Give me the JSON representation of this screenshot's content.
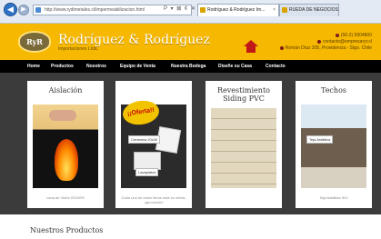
{
  "browser": {
    "url": "http://www.rydimetales.cl/impermeabilizacion.html",
    "address_tools": "P ▾ ⊠ ¢ ✕",
    "tabs": [
      {
        "label": "Rodríguez & Rodríguez Im...",
        "close": "×"
      },
      {
        "label": "RUEDA DE NEGOCIOS",
        "close": ""
      }
    ]
  },
  "header": {
    "logo_text": "RyR",
    "brand": "Rodríguez & Rodríguez",
    "tagline": "Importaciones Ltda.",
    "phone": "(56-2) 5904800",
    "email": "contacto@empresaryr.cl",
    "address": "Román Díaz 205, Providencia - Stgo. Chile"
  },
  "nav": {
    "items": [
      "Home",
      "Productos",
      "Nosotros",
      "Equipo de Venta",
      "Nuestra Bodega",
      "Diseñe su Casa",
      "Contacto"
    ]
  },
  "cards": [
    {
      "title": "Aislación",
      "caption": "Lana de Vidrio ISOVER"
    },
    {
      "title": "",
      "badge": "¡¡Oferta!!",
      "tag1": "Cerámica 20x30",
      "tag2": "Lavaplatos",
      "caption": "Cada uno de estos items está en oferta, ¡aproveche!"
    },
    {
      "title": "Revestimiento Siding PVC",
      "caption": ""
    },
    {
      "title": "Techos",
      "tag": "Teja Asfáltica",
      "caption": "Teja Asfáltica IKO"
    }
  ],
  "main": {
    "section_title": "Nuestros Productos"
  },
  "colors": {
    "header_bg": "#f6b800",
    "nav_bg": "#000000",
    "content_bg": "#3b3b3b"
  }
}
